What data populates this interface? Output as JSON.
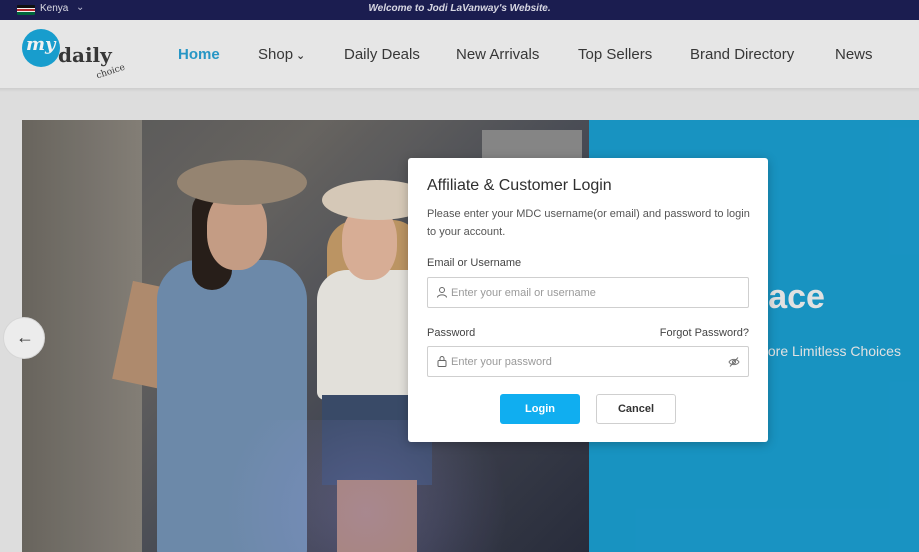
{
  "topbar": {
    "country": "Kenya",
    "welcome": "Welcome to Jodi LaVanway's Website."
  },
  "logo": {
    "my": "my",
    "daily": "daily",
    "choice": "choice"
  },
  "nav": {
    "items": [
      {
        "label": "Home",
        "active": true
      },
      {
        "label": "Shop",
        "has_dropdown": true
      },
      {
        "label": "Daily Deals"
      },
      {
        "label": "New Arrivals"
      },
      {
        "label": "Top Sellers"
      },
      {
        "label": "Brand Directory"
      },
      {
        "label": "News"
      }
    ]
  },
  "hero": {
    "title_fragment": "place",
    "subtitle_fragment": "plore Limitless Choices",
    "accent_color": "#1a9bcc"
  },
  "modal": {
    "title": "Affiliate & Customer Login",
    "description": "Please enter your MDC username(or email) and password to login to your account.",
    "email_label": "Email or Username",
    "email_placeholder": "Enter your email or username",
    "password_label": "Password",
    "forgot_password": "Forgot Password?",
    "password_placeholder": "Enter your password",
    "login_button": "Login",
    "cancel_button": "Cancel",
    "button_color": "#10aef0"
  },
  "icons": {
    "user": "user-icon",
    "lock": "lock-icon",
    "eye": "eye-slash-icon",
    "arrow": "arrow-left-icon",
    "chevron": "chevron-down-icon"
  }
}
